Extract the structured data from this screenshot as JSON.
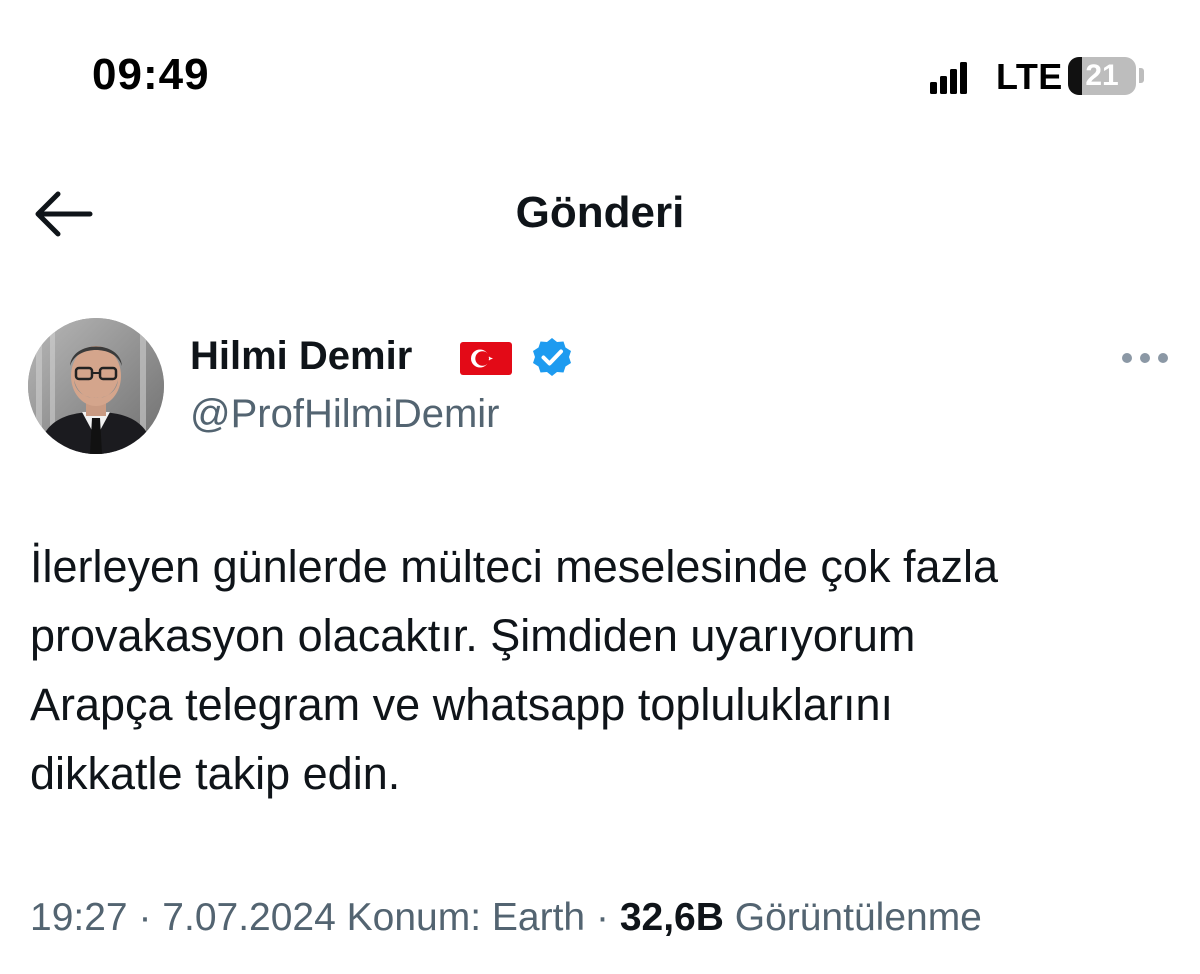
{
  "status_bar": {
    "time": "09:49",
    "network": "LTE",
    "battery_level": "21",
    "battery_fraction": 0.21,
    "signal_bars_filled": 4
  },
  "header": {
    "title": "Gönderi",
    "back_icon": "arrow-left-icon"
  },
  "post": {
    "author": {
      "display_name": "Hilmi Demir",
      "flag_icon": "turkey-flag-icon",
      "verified_icon": "verified-badge-icon",
      "handle": "@ProfHilmiDemir"
    },
    "more_icon": "more-options-icon",
    "text_lines": [
      "İlerleyen günlerde mülteci meselesinde çok fazla",
      "provakasyon olacaktır. Şimdiden uyarıyorum",
      "Arapça telegram ve whatsapp topluluklarını",
      "dikkatle takip edin."
    ],
    "meta": {
      "time": "19:27",
      "separator": "·",
      "date": "7.07.2024",
      "location": "Konum: Earth",
      "views_count": "32,6B",
      "views_label": "Görüntülenme"
    }
  },
  "colors": {
    "text_primary": "#0f1419",
    "text_secondary": "#536471",
    "verified_blue": "#1d9bf0",
    "flag_red": "#e30a17",
    "background": "#ffffff"
  }
}
